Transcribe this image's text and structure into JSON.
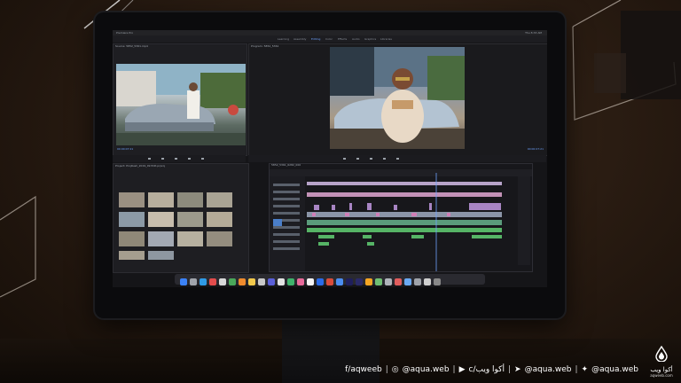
{
  "screen": {
    "menu_bar": {
      "app": "Premiere Pro",
      "clock": "Thu 8:33 AM"
    },
    "workspace_tabs": [
      "Learning",
      "Assembly",
      "Editing",
      "Color",
      "Effects",
      "Audio",
      "Graphics",
      "Libraries"
    ],
    "active_tab": 2,
    "source_panel_label": "Source: 5852_5361.mp4",
    "program_panel_label": "Program: 5852_5361",
    "timeline_label": "5852_5361_6282_000",
    "project_label": "Project: ProjRush_2019_09 Edit.prproj",
    "source_timecode": "00:00:07:21",
    "program_timecode": "00:00:07:21"
  },
  "footer": {
    "facebook": "f/aqweeb",
    "instagram": "@aqua.web",
    "youtube": "c/أكوا ويب",
    "telegram": "@aqua.web",
    "twitter": "@aqua.web",
    "separator": "|"
  },
  "logo": {
    "name": "أكوا ويب",
    "site": "aqweeb.com"
  },
  "colors": {
    "accent_blue": "#6fa3ff",
    "clip_pink": "#d07fb7",
    "clip_green": "#56b466",
    "clip_purple": "#8a6fc4"
  },
  "icons": [
    "facebook-icon",
    "instagram-icon",
    "youtube-icon",
    "telegram-icon",
    "twitter-icon",
    "water-drop-logo-icon"
  ]
}
